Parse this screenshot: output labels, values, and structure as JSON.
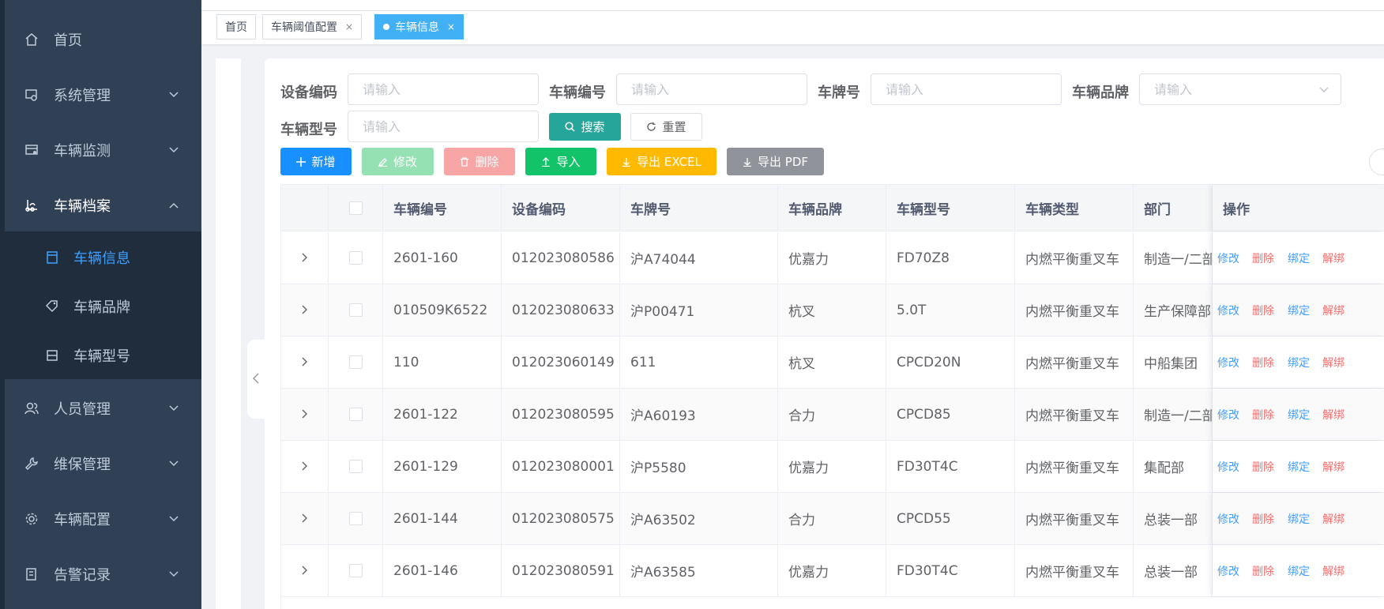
{
  "sidebar": {
    "items": [
      {
        "label": "首页",
        "icon": "home-icon"
      },
      {
        "label": "系统管理",
        "icon": "system-icon"
      },
      {
        "label": "车辆监测",
        "icon": "monitor-icon"
      },
      {
        "label": "车辆档案",
        "icon": "archive-icon"
      },
      {
        "label": "人员管理",
        "icon": "people-icon"
      },
      {
        "label": "维保管理",
        "icon": "wrench-icon"
      },
      {
        "label": "车辆配置",
        "icon": "config-icon"
      },
      {
        "label": "告警记录",
        "icon": "alarm-record-icon"
      }
    ],
    "sub_items": [
      {
        "label": "车辆信息",
        "icon": "document-icon",
        "active": true
      },
      {
        "label": "车辆品牌",
        "icon": "tag-icon"
      },
      {
        "label": "车辆型号",
        "icon": "model-icon"
      }
    ]
  },
  "tags": [
    {
      "label": "首页"
    },
    {
      "label": "车辆阈值配置",
      "close": "×"
    },
    {
      "label": "车辆信息",
      "close": "×",
      "active": true
    }
  ],
  "search": {
    "device_code_label": "设备编码",
    "vehicle_no_label": "车辆编号",
    "plate_label": "车牌号",
    "brand_label": "车辆品牌",
    "model_label": "车辆型号",
    "placeholder": "请输入",
    "search_btn": "搜索",
    "reset_btn": "重置"
  },
  "toolbar": {
    "add": "新增",
    "edit": "修改",
    "delete": "删除",
    "import": "导入",
    "export_excel": "导出 EXCEL",
    "export_pdf": "导出 PDF"
  },
  "table": {
    "headers": [
      "车辆编号",
      "设备编码",
      "车牌号",
      "车辆品牌",
      "车辆型号",
      "车辆类型",
      "部门",
      "操作"
    ],
    "ops": {
      "edit": "修改",
      "delete": "删除",
      "bind": "绑定",
      "unbind": "解绑"
    },
    "rows": [
      {
        "no": "2601-160",
        "device": "012023080586",
        "plate": "沪A74044",
        "brand": "优嘉力",
        "model": "FD70Z8",
        "type": "内燃平衡重叉车",
        "dept": "制造一/二部"
      },
      {
        "no": "010509K6522",
        "device": "012023080633",
        "plate": "沪P00471",
        "brand": "杭叉",
        "model": "5.0T",
        "type": "内燃平衡重叉车",
        "dept": "生产保障部"
      },
      {
        "no": "110",
        "device": "012023060149",
        "plate": "611",
        "brand": "杭叉",
        "model": "CPCD20N",
        "type": "内燃平衡重叉车",
        "dept": "中船集团"
      },
      {
        "no": "2601-122",
        "device": "012023080595",
        "plate": "沪A60193",
        "brand": "合力",
        "model": "CPCD85",
        "type": "内燃平衡重叉车",
        "dept": "制造一/二部"
      },
      {
        "no": "2601-129",
        "device": "012023080001",
        "plate": "沪P5580",
        "brand": "优嘉力",
        "model": "FD30T4C",
        "type": "内燃平衡重叉车",
        "dept": "集配部"
      },
      {
        "no": "2601-144",
        "device": "012023080575",
        "plate": "沪A63502",
        "brand": "合力",
        "model": "CPCD55",
        "type": "内燃平衡重叉车",
        "dept": "总装一部"
      },
      {
        "no": "2601-146",
        "device": "012023080591",
        "plate": "沪A63585",
        "brand": "优嘉力",
        "model": "FD30T4C",
        "type": "内燃平衡重叉车",
        "dept": "总装一部"
      }
    ]
  }
}
